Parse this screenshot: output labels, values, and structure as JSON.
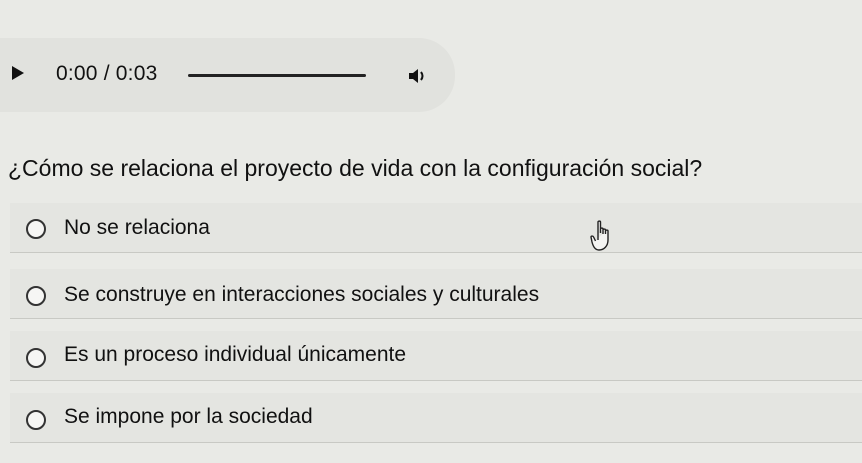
{
  "audio": {
    "time": "0:00 / 0:03",
    "progress_fraction": 0,
    "play_icon": "play-icon",
    "volume_icon": "volume-icon"
  },
  "question": {
    "text": "¿Cómo se relaciona el proyecto de vida con la configuración social?"
  },
  "options": [
    {
      "label": "No se relaciona"
    },
    {
      "label": "Se construye en interacciones sociales y culturales"
    },
    {
      "label": "Es un proceso individual únicamente"
    },
    {
      "label": "Se impone por la sociedad"
    }
  ],
  "cursor": {
    "icon": "hand-pointer-icon"
  }
}
